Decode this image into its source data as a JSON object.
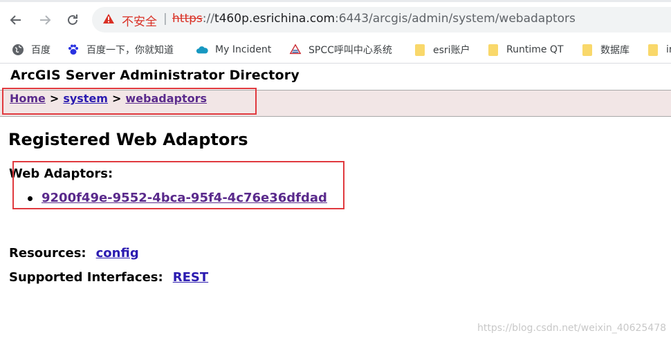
{
  "browser": {
    "security_label": "不安全",
    "separator": "|",
    "url": {
      "scheme": "https",
      "slashes": "://",
      "host": "t460p.esrichina.com",
      "path": ":6443/arcgis/admin/system/webadaptors"
    }
  },
  "bookmarks": [
    {
      "label": "百度",
      "icon": "globe-icon"
    },
    {
      "label": "百度一下，你就知道",
      "icon": "paw-icon"
    },
    {
      "label": "My Incident",
      "icon": "cloud-icon"
    },
    {
      "label": "SPCC呼叫中心系统",
      "icon": "spcc-logo-icon"
    },
    {
      "label": "esri账户",
      "icon": "folder-icon"
    },
    {
      "label": "Runtime QT",
      "icon": "folder-icon"
    },
    {
      "label": "数据库",
      "icon": "folder-icon"
    },
    {
      "label": "in",
      "icon": "folder-icon"
    }
  ],
  "page": {
    "title": "ArcGIS Server Administrator Directory",
    "breadcrumb": {
      "home": "Home",
      "system": "system",
      "webadaptors": "webadaptors",
      "separator": ">"
    },
    "heading": "Registered Web Adaptors",
    "web_adaptors_label": "Web Adaptors:",
    "web_adaptors": [
      "9200f49e-9552-4bca-95f4-4c76e36dfdad"
    ],
    "resources_label": "Resources:",
    "resources_link": "config",
    "interfaces_label": "Supported Interfaces:",
    "interfaces_link": "REST"
  },
  "watermark": "https://blog.csdn.net/weixin_40625478",
  "colors": {
    "highlight_box": "#e0393e",
    "breadcrumb_bg": "#f2e6e6",
    "link": "#2b1bb0",
    "visited_link": "#5a2a8c",
    "insecure": "#d93025"
  }
}
